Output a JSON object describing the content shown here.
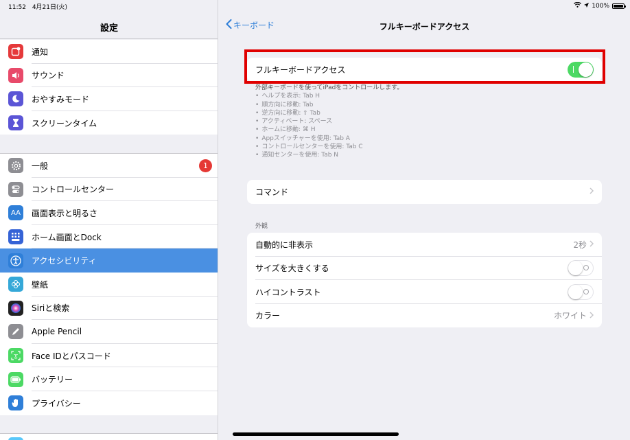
{
  "status": {
    "time": "11:52",
    "date": "4月21日(火)",
    "battery_text": "100%"
  },
  "sidebar": {
    "title": "設定",
    "group1": [
      {
        "label": "通知",
        "icon": "notifications-icon",
        "color": "#e5393a"
      },
      {
        "label": "サウンド",
        "icon": "speaker-icon",
        "color": "#e84a6a"
      },
      {
        "label": "おやすみモード",
        "icon": "moon-icon",
        "color": "#5b55d6"
      },
      {
        "label": "スクリーンタイム",
        "icon": "hourglass-icon",
        "color": "#5b55d6"
      }
    ],
    "group2": [
      {
        "label": "一般",
        "icon": "gear-icon",
        "color": "#8e8e93",
        "badge": "1"
      },
      {
        "label": "コントロールセンター",
        "icon": "switches-icon",
        "color": "#8e8e93"
      },
      {
        "label": "画面表示と明るさ",
        "icon": "text-size-icon",
        "glyph": "AA",
        "color": "#2f7fd8"
      },
      {
        "label": "ホーム画面とDock",
        "icon": "home-grid-icon",
        "color": "#3563d6"
      },
      {
        "label": "アクセシビリティ",
        "icon": "accessibility-icon",
        "color": "#2f7fd8",
        "selected": true
      },
      {
        "label": "壁紙",
        "icon": "flower-icon",
        "color": "#35a8d8"
      },
      {
        "label": "Siriと検索",
        "icon": "siri-icon",
        "color": "#222222"
      },
      {
        "label": "Apple Pencil",
        "icon": "pencil-icon",
        "color": "#8e8e93"
      },
      {
        "label": "Face IDとパスコード",
        "icon": "face-id-icon",
        "color": "#4cd964"
      },
      {
        "label": "バッテリー",
        "icon": "battery-icon",
        "color": "#4cd964"
      },
      {
        "label": "プライバシー",
        "icon": "hand-icon",
        "color": "#2f7fd8"
      }
    ],
    "group3_icon_color": "#5ac8fa"
  },
  "detail": {
    "back_label": "キーボード",
    "title": "フルキーボードアクセス",
    "main_toggle": {
      "label": "フルキーボードアクセス",
      "on": true
    },
    "description": {
      "title": "外部キーボードを使ってiPadをコントロールします。",
      "lines": [
        "ヘルプを表示: Tab H",
        "順方向に移動: Tab",
        "逆方向に移動: ⇧ Tab",
        "アクティベート: スペース",
        "ホームに移動: ⌘ H",
        "Appスイッチャーを使用: Tab A",
        "コントロールセンターを使用: Tab C",
        "通知センターを使用: Tab N"
      ]
    },
    "commands_label": "コマンド",
    "appearance_header": "外観",
    "appearance": {
      "auto_hide": {
        "label": "自動的に非表示",
        "value": "2秒"
      },
      "bigger_size": {
        "label": "サイズを大きくする",
        "on": false
      },
      "high_contrast": {
        "label": "ハイコントラスト",
        "on": false
      },
      "color": {
        "label": "カラー",
        "value": "ホワイト"
      }
    }
  },
  "colors": {
    "accent": "#2f7fd8",
    "toggle_on": "#4cd964",
    "highlight": "#e00000",
    "selected_row": "#4a90e2"
  }
}
